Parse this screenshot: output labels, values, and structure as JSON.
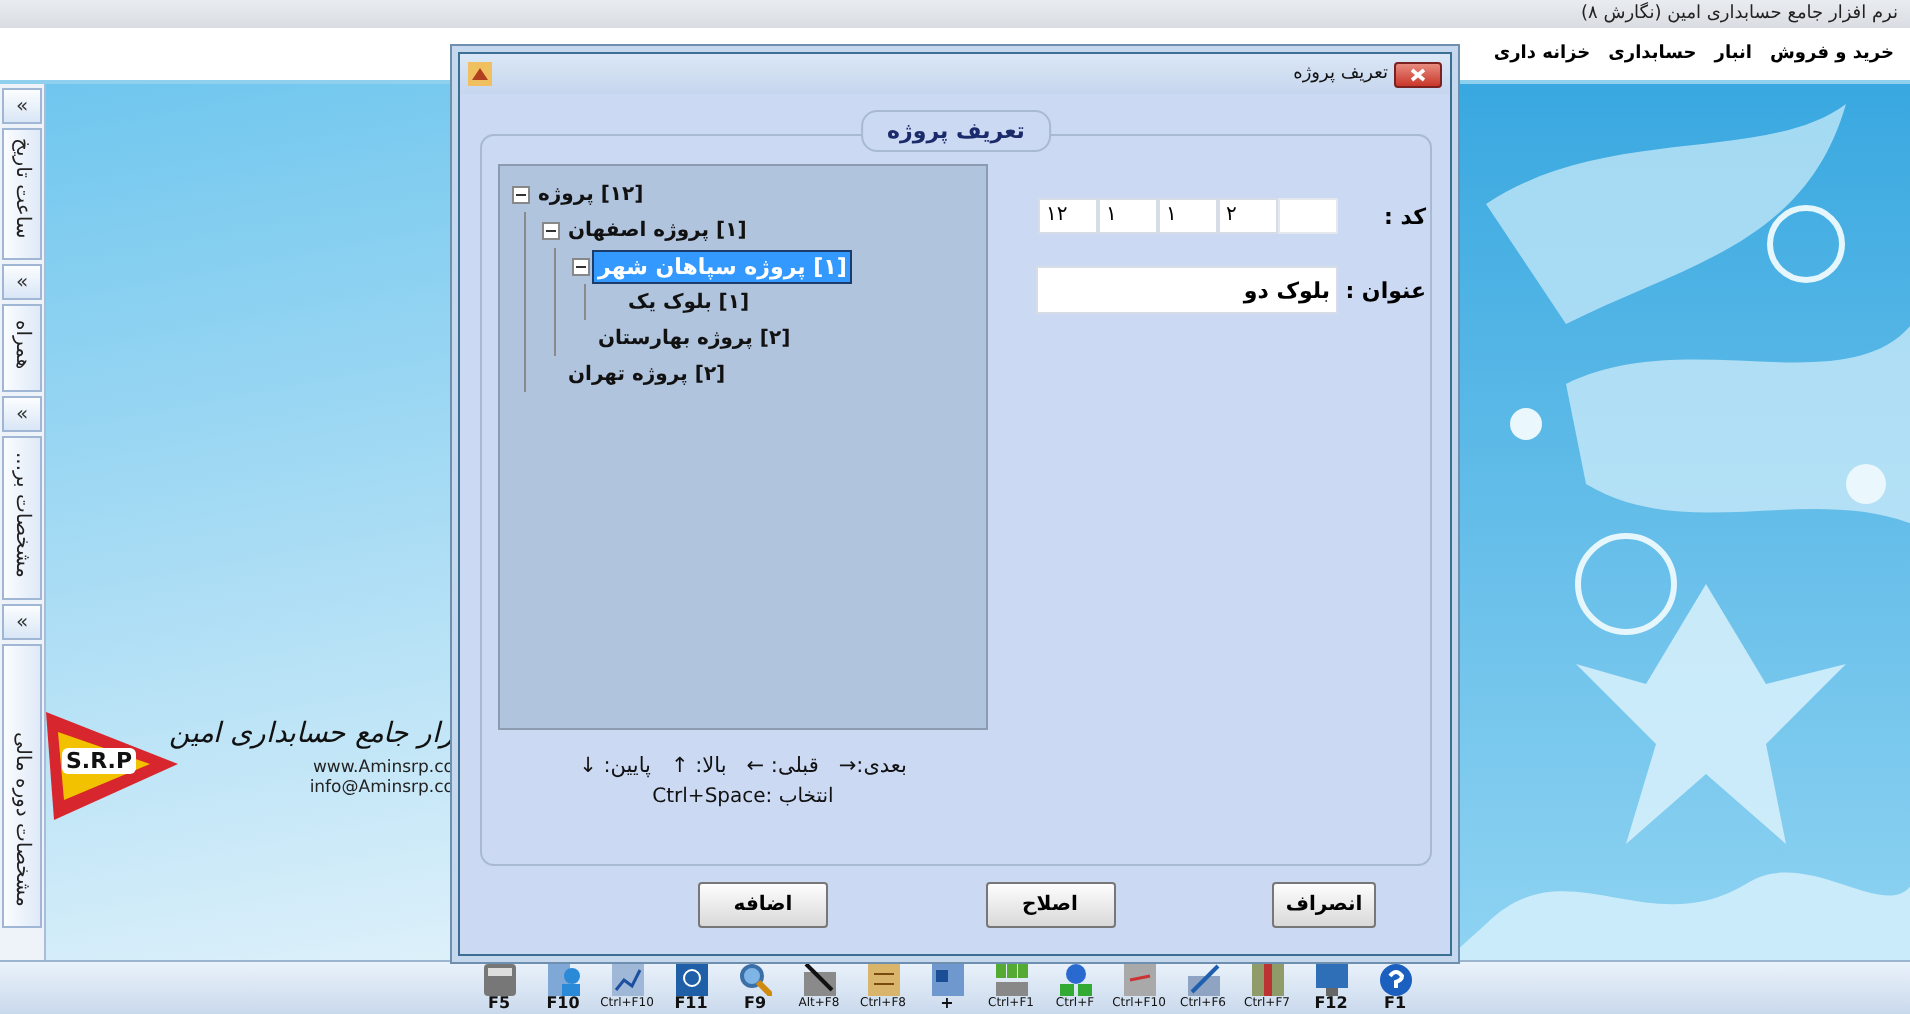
{
  "window": {
    "title": "نرم افزار جامع حسابداری امین (نگارش ۸)"
  },
  "menu": [
    {
      "label": "خرید و فروش"
    },
    {
      "label": "انبار"
    },
    {
      "label": "حسابداری"
    },
    {
      "label": "خزانه داری"
    }
  ],
  "side_panels": [
    {
      "toggle": "«",
      "label": "ساعت تاریخ"
    },
    {
      "toggle": "«",
      "label": "همراه"
    },
    {
      "toggle": "«",
      "label": "مشخصات بر..."
    },
    {
      "toggle": "«",
      "label": "مشخصات دوره مالی"
    }
  ],
  "logo": {
    "badge": "S.R.P",
    "title": "زار جامع حسابداری امین",
    "lines": [
      "www.Aminsrp.co",
      "info@Aminsrp.co"
    ]
  },
  "dialog": {
    "title": "تعریف پروژه",
    "group_title": "تعریف پروژه",
    "tree": [
      {
        "label": "[۱۲] پروژه",
        "expanded": true,
        "selected": false,
        "children": [
          {
            "label": "[۱] پروژه اصفهان",
            "expanded": true,
            "selected": false,
            "children": [
              {
                "label": "[۱] پروژه سپاهان شهر",
                "expanded": true,
                "selected": true,
                "children": [
                  {
                    "label": "[۱] بلوک یک",
                    "selected": false
                  }
                ]
              },
              {
                "label": "[۲] پروژه بهارستان",
                "selected": false
              }
            ]
          },
          {
            "label": "[۲] پروژه تهران",
            "selected": false
          }
        ]
      }
    ],
    "code": {
      "label": "کد :",
      "parts": [
        {
          "filled": false
        },
        {
          "filled": true,
          "value": "۲"
        },
        {
          "filled": true,
          "value": "۱"
        },
        {
          "filled": true,
          "value": "۱"
        },
        {
          "filled": true,
          "value": "۱۲"
        }
      ]
    },
    "title_field": {
      "label": "عنوان :",
      "value": "بلوک دو"
    },
    "hints": [
      "بعدی:→",
      "قبلی: ←",
      "بالا: ↑",
      "پایین: ↓"
    ],
    "select_hint": "انتخاب :Ctrl+Space",
    "buttons": [
      {
        "label": "انصراف"
      },
      {
        "label": "اصلاح"
      },
      {
        "label": "اضافه"
      }
    ]
  },
  "toolbar": [
    {
      "label": "F1"
    },
    {
      "label": "F12"
    },
    {
      "label": "Ctrl+F7"
    },
    {
      "label": "Ctrl+F6"
    },
    {
      "label": "Ctrl+F10"
    },
    {
      "label": "Ctrl+F"
    },
    {
      "label": "Ctrl+F1"
    },
    {
      "label": "+"
    },
    {
      "label": "Ctrl+F8"
    },
    {
      "label": "Alt+F8"
    },
    {
      "label": "F9"
    },
    {
      "label": "F11"
    },
    {
      "label": "Ctrl+F10"
    },
    {
      "label": "F10"
    },
    {
      "label": "F5"
    }
  ]
}
